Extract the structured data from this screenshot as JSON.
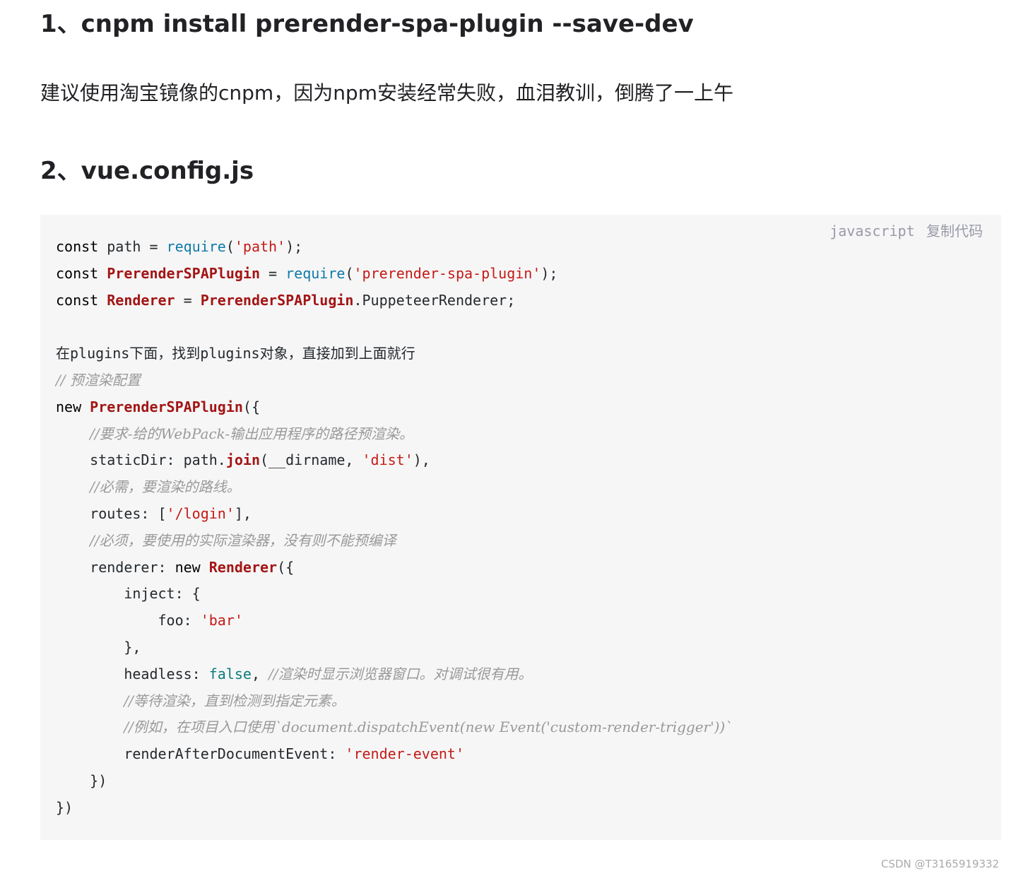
{
  "heading1": "1、cnpm install prerender-spa-plugin --save-dev",
  "paragraph": "建议使用淘宝镜像的cnpm，因为npm安装经常失败，血泪教训，倒腾了一上午",
  "heading2": "2、vue.config.js",
  "code_block": {
    "language": "javascript",
    "copy_label": "复制代码",
    "lines": [
      [
        {
          "t": "const",
          "c": "kw"
        },
        {
          "t": " path = ",
          "c": ""
        },
        {
          "t": "require",
          "c": "fn"
        },
        {
          "t": "(",
          "c": ""
        },
        {
          "t": "'path'",
          "c": "str"
        },
        {
          "t": ");",
          "c": ""
        }
      ],
      [
        {
          "t": "const",
          "c": "kw"
        },
        {
          "t": " ",
          "c": ""
        },
        {
          "t": "PrerenderSPAPlugin",
          "c": "cls"
        },
        {
          "t": " = ",
          "c": ""
        },
        {
          "t": "require",
          "c": "fn"
        },
        {
          "t": "(",
          "c": ""
        },
        {
          "t": "'prerender-spa-plugin'",
          "c": "str"
        },
        {
          "t": ");",
          "c": ""
        }
      ],
      [
        {
          "t": "const",
          "c": "kw"
        },
        {
          "t": " ",
          "c": ""
        },
        {
          "t": "Renderer",
          "c": "cls"
        },
        {
          "t": " = ",
          "c": ""
        },
        {
          "t": "PrerenderSPAPlugin",
          "c": "cls"
        },
        {
          "t": ".PuppeteerRenderer;",
          "c": ""
        }
      ],
      [],
      [
        {
          "t": "在plugins下面，找到plugins对象，直接加到上面就行",
          "c": ""
        }
      ],
      [
        {
          "t": "// 预渲染配置",
          "c": "cm"
        }
      ],
      [
        {
          "t": "new",
          "c": "kw"
        },
        {
          "t": " ",
          "c": ""
        },
        {
          "t": "PrerenderSPAPlugin",
          "c": "cls"
        },
        {
          "t": "({",
          "c": ""
        }
      ],
      [
        {
          "t": "    ",
          "c": ""
        },
        {
          "t": "//要求-给的WebPack-输出应用程序的路径预渲染。",
          "c": "cm"
        }
      ],
      [
        {
          "t": "    staticDir: path.",
          "c": ""
        },
        {
          "t": "join",
          "c": "met"
        },
        {
          "t": "(__dirname, ",
          "c": ""
        },
        {
          "t": "'dist'",
          "c": "str"
        },
        {
          "t": "),",
          "c": ""
        }
      ],
      [
        {
          "t": "    ",
          "c": ""
        },
        {
          "t": "//必需，要渲染的路线。",
          "c": "cm"
        }
      ],
      [
        {
          "t": "    routes: [",
          "c": ""
        },
        {
          "t": "'/login'",
          "c": "str"
        },
        {
          "t": "],",
          "c": ""
        }
      ],
      [
        {
          "t": "    ",
          "c": ""
        },
        {
          "t": "//必须，要使用的实际渲染器，没有则不能预编译",
          "c": "cm"
        }
      ],
      [
        {
          "t": "    renderer: ",
          "c": ""
        },
        {
          "t": "new",
          "c": "kw"
        },
        {
          "t": " ",
          "c": ""
        },
        {
          "t": "Renderer",
          "c": "cls"
        },
        {
          "t": "({",
          "c": ""
        }
      ],
      [
        {
          "t": "        inject: {",
          "c": ""
        }
      ],
      [
        {
          "t": "            foo: ",
          "c": ""
        },
        {
          "t": "'bar'",
          "c": "str"
        }
      ],
      [
        {
          "t": "        },",
          "c": ""
        }
      ],
      [
        {
          "t": "        headless: ",
          "c": ""
        },
        {
          "t": "false",
          "c": "lit"
        },
        {
          "t": ", ",
          "c": ""
        },
        {
          "t": "//渲染时显示浏览器窗口。对调试很有用。",
          "c": "cm"
        }
      ],
      [
        {
          "t": "        ",
          "c": ""
        },
        {
          "t": "//等待渲染，直到检测到指定元素。",
          "c": "cm"
        }
      ],
      [
        {
          "t": "        ",
          "c": ""
        },
        {
          "t": "//例如，在项目入口使用`document.dispatchEvent(new Event('custom-render-trigger'))`",
          "c": "cm"
        }
      ],
      [
        {
          "t": "        renderAfterDocumentEvent: ",
          "c": ""
        },
        {
          "t": "'render-event'",
          "c": "str"
        }
      ],
      [
        {
          "t": "    })",
          "c": ""
        }
      ],
      [
        {
          "t": "})",
          "c": ""
        }
      ]
    ]
  },
  "watermark": "CSDN @T3165919332"
}
